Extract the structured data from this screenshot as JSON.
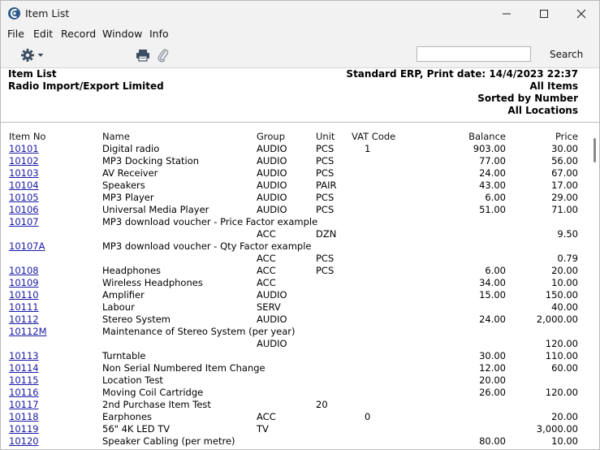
{
  "window": {
    "title": "Item List",
    "icon": "app-logo-icon"
  },
  "menu": [
    "File",
    "Edit",
    "Record",
    "Window",
    "Info"
  ],
  "toolbar": {
    "search_label": "Search",
    "search_value": "",
    "icons": [
      "gear-icon",
      "printer-icon",
      "paperclip-icon"
    ]
  },
  "report": {
    "title": "Item List",
    "company": "Radio Import/Export Limited",
    "meta": "Standard ERP, Print date:  14/4/2023 22:37",
    "scope": "All Items",
    "sort": "Sorted by Number",
    "locations": "All Locations"
  },
  "columns": {
    "item_no": "Item No",
    "name": "Name",
    "group": "Group",
    "unit": "Unit",
    "vat": "VAT Code",
    "balance": "Balance",
    "price": "Price"
  },
  "rows": [
    {
      "no": "10101",
      "name": "Digital radio",
      "group": "AUDIO",
      "unit": "PCS",
      "vat": "1",
      "balance": "903.00",
      "price": "30.00"
    },
    {
      "no": "10102",
      "name": "MP3 Docking Station",
      "group": "AUDIO",
      "unit": "PCS",
      "vat": "",
      "balance": "77.00",
      "price": "56.00"
    },
    {
      "no": "10103",
      "name": "AV Receiver",
      "group": "AUDIO",
      "unit": "PCS",
      "vat": "",
      "balance": "24.00",
      "price": "67.00"
    },
    {
      "no": "10104",
      "name": "Speakers",
      "group": "AUDIO",
      "unit": "PAIR",
      "vat": "",
      "balance": "43.00",
      "price": "17.00"
    },
    {
      "no": "10105",
      "name": "MP3 Player",
      "group": "AUDIO",
      "unit": "PCS",
      "vat": "",
      "balance": "6.00",
      "price": "29.00"
    },
    {
      "no": "10106",
      "name": "Universal Media Player",
      "group": "AUDIO",
      "unit": "PCS",
      "vat": "",
      "balance": "51.00",
      "price": "71.00"
    },
    {
      "no": "10107",
      "name": "MP3 download voucher - Price Factor example",
      "group": "",
      "unit": "",
      "vat": "",
      "balance": "",
      "price": ""
    },
    {
      "no": "",
      "name": "",
      "group": "ACC",
      "unit": "DZN",
      "vat": "",
      "balance": "",
      "price": "9.50"
    },
    {
      "no": "10107A",
      "name": "MP3 download voucher - Qty Factor example",
      "group": "",
      "unit": "",
      "vat": "",
      "balance": "",
      "price": ""
    },
    {
      "no": "",
      "name": "",
      "group": "ACC",
      "unit": "PCS",
      "vat": "",
      "balance": "",
      "price": "0.79"
    },
    {
      "no": "10108",
      "name": "Headphones",
      "group": "ACC",
      "unit": "PCS",
      "vat": "",
      "balance": "6.00",
      "price": "20.00"
    },
    {
      "no": "10109",
      "name": "Wireless Headphones",
      "group": "ACC",
      "unit": "",
      "vat": "",
      "balance": "34.00",
      "price": "10.00"
    },
    {
      "no": "10110",
      "name": "Amplifier",
      "group": "AUDIO",
      "unit": "",
      "vat": "",
      "balance": "15.00",
      "price": "150.00"
    },
    {
      "no": "10111",
      "name": "Labour",
      "group": "SERV",
      "unit": "",
      "vat": "",
      "balance": "",
      "price": "40.00"
    },
    {
      "no": "10112",
      "name": "Stereo System",
      "group": "AUDIO",
      "unit": "",
      "vat": "",
      "balance": "24.00",
      "price": "2,000.00"
    },
    {
      "no": "10112M",
      "name": "Maintenance of Stereo System (per year)",
      "group": "",
      "unit": "",
      "vat": "",
      "balance": "",
      "price": ""
    },
    {
      "no": "",
      "name": "",
      "group": "AUDIO",
      "unit": "",
      "vat": "",
      "balance": "",
      "price": "120.00"
    },
    {
      "no": "10113",
      "name": "Turntable",
      "group": "",
      "unit": "",
      "vat": "",
      "balance": "30.00",
      "price": "110.00"
    },
    {
      "no": "10114",
      "name": "Non Serial Numbered Item Change",
      "group": "",
      "unit": "",
      "vat": "",
      "balance": "12.00",
      "price": "60.00"
    },
    {
      "no": "10115",
      "name": "Location Test",
      "group": "",
      "unit": "",
      "vat": "",
      "balance": "20.00",
      "price": ""
    },
    {
      "no": "10116",
      "name": "Moving Coil Cartridge",
      "group": "",
      "unit": "",
      "vat": "",
      "balance": "26.00",
      "price": "120.00"
    },
    {
      "no": "10117",
      "name": "2nd Purchase Item Test",
      "group": "",
      "unit": "20",
      "vat": "",
      "balance": "",
      "price": ""
    },
    {
      "no": "10118",
      "name": "Earphones",
      "group": "ACC",
      "unit": "",
      "vat": "0",
      "balance": "",
      "price": "20.00"
    },
    {
      "no": "10119",
      "name": "56\" 4K LED TV",
      "group": "TV",
      "unit": "",
      "vat": "",
      "balance": "",
      "price": "3,000.00"
    },
    {
      "no": "10120",
      "name": "Speaker Cabling (per metre)",
      "group": "",
      "unit": "",
      "vat": "",
      "balance": "80.00",
      "price": "10.00"
    }
  ]
}
